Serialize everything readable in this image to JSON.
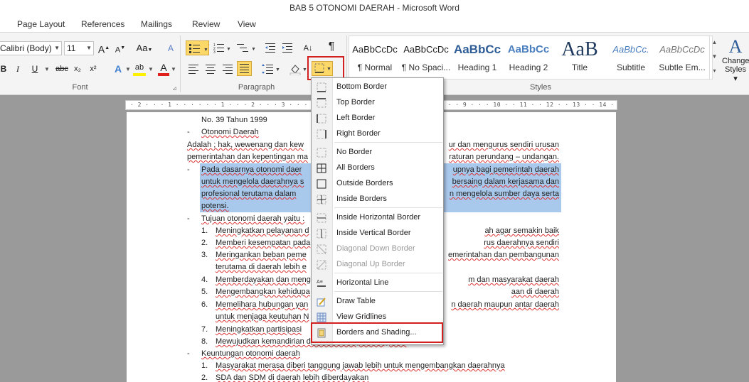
{
  "window": {
    "title": "BAB 5 OTONOMI DAERAH  -  Microsoft Word"
  },
  "tabs": [
    "Page Layout",
    "References",
    "Mailings",
    "Review",
    "View"
  ],
  "font": {
    "name": "Calibri (Body)",
    "size": "11",
    "grow": "A",
    "shrink": "A",
    "case": "Aa",
    "clear": "A"
  },
  "font_buttons": {
    "bold": "B",
    "italic": "I",
    "underline": "U",
    "strike": "abc",
    "sub": "x₂",
    "sup": "x²",
    "effects": "A",
    "highlight": "ab",
    "color": "A"
  },
  "groups": {
    "font": "Font",
    "paragraph": "Paragraph",
    "styles": "Styles"
  },
  "paragraph": {
    "pilcrow": "¶",
    "sort": "A↓"
  },
  "styles": [
    {
      "sample": "AaBbCcDc",
      "name": "¶ Normal"
    },
    {
      "sample": "AaBbCcDc",
      "name": "¶ No Spaci..."
    },
    {
      "sample": "AaBbCc",
      "name": "Heading 1"
    },
    {
      "sample": "AaBbCc",
      "name": "Heading 2"
    },
    {
      "sample": "AaB",
      "name": "Title"
    },
    {
      "sample": "AaBbCc.",
      "name": "Subtitle"
    },
    {
      "sample": "AaBbCcDc",
      "name": "Subtle Em..."
    }
  ],
  "change_styles": {
    "line1": "Change",
    "line2": "Styles ▾"
  },
  "ruler": {
    "text": "· 2 · · · 1 · · · · · · 1 · · · 2 · · · 3 · · · 4 · · · 5 · · · 6 · · · 7 · · · 8 · · · 9 · · · 10 · · 11 · · 12 · · 13 · · 14 · · 15 · · · · 17 · · 18 · · 19"
  },
  "document": {
    "l1": "No. 39 Tahun 1999",
    "l2_bullet": "-",
    "l2": "Otonomi Daerah",
    "l3a": "Adalah ; hak, wewenang dan kew",
    "l3b": "ur dan mengurus sendiri urusan",
    "l4a": "pemerintahan dan kepentingan ma",
    "l4b": "raturan perundang – undangan.",
    "p1_bullet": "-",
    "p1_1a": "Pada dasarnya otonomi daer",
    "p1_1b": "upnya bagi pemerintah daerah",
    "p1_2a": "untuk mengelola daerahnya s",
    "p1_2b": "bersaing dalam kerjasama dan",
    "p1_3a": "profesional terutama dalam",
    "p1_3b": "n mengelola sumber daya serta",
    "p1_4": "potensi.",
    "t_bullet": "-",
    "t": "Tujuan otonomi daerah yaitu :",
    "items": [
      {
        "n": "1.",
        "a": "Meningkatkan pelayanan d",
        "b": "ah agar semakin baik"
      },
      {
        "n": "2.",
        "a": "Memberi kesempatan pada",
        "b": "rus daerahnya sendiri"
      },
      {
        "n": "3.",
        "a": "Meringankan beban peme",
        "b": "emerintahan dan pembangunan"
      },
      {
        "n": "",
        "a": "terutama di daerah lebih e",
        "b": ""
      },
      {
        "n": "4.",
        "a": "Memberdayakan dan meng",
        "b": "m dan masyarakat daerah"
      },
      {
        "n": "5.",
        "a": "Mengembangkan kehidupa",
        "b": "aan di daerah"
      },
      {
        "n": "6.",
        "a": "Memelihara hubungan yan",
        "b": "n daerah maupun antar daerah"
      },
      {
        "n": "",
        "a": "untuk menjaga keutuhan N",
        "b": ""
      },
      {
        "n": "7.",
        "a": "Meningkatkan partisipasi",
        "b": ""
      },
      {
        "n": "8.",
        "a": "Mewujudkan kemandirian daerah dalam pembangunan",
        "b": ""
      }
    ],
    "k_bullet": "-",
    "k": "Keuntungan otonomi daerah",
    "k1n": "1.",
    "k1": "Masyarakat merasa diberi tanggung jawab lebih untuk mengembangkan daerahnya",
    "k2n": "2.",
    "k2": "SDA dan SDM di daerah lebih diberdayakan"
  },
  "menu": {
    "items": [
      {
        "label": "Bottom Border",
        "icon": "bottom-border-icon",
        "disabled": false
      },
      {
        "label": "Top Border",
        "icon": "top-border-icon",
        "disabled": false
      },
      {
        "label": "Left Border",
        "icon": "left-border-icon",
        "disabled": false
      },
      {
        "label": "Right Border",
        "icon": "right-border-icon",
        "disabled": false
      },
      {
        "label": "No Border",
        "icon": "no-border-icon",
        "disabled": false
      },
      {
        "label": "All Borders",
        "icon": "all-borders-icon",
        "disabled": false
      },
      {
        "label": "Outside Borders",
        "icon": "outside-borders-icon",
        "disabled": false
      },
      {
        "label": "Inside Borders",
        "icon": "inside-borders-icon",
        "disabled": false
      },
      {
        "label": "Inside Horizontal Border",
        "icon": "inside-horizontal-border-icon",
        "disabled": false
      },
      {
        "label": "Inside Vertical Border",
        "icon": "inside-vertical-border-icon",
        "disabled": false
      },
      {
        "label": "Diagonal Down Border",
        "icon": "diagonal-down-border-icon",
        "disabled": true
      },
      {
        "label": "Diagonal Up Border",
        "icon": "diagonal-up-border-icon",
        "disabled": true
      },
      {
        "label": "Horizontal Line",
        "icon": "horizontal-line-icon",
        "disabled": false
      },
      {
        "label": "Draw Table",
        "icon": "draw-table-icon",
        "disabled": false
      },
      {
        "label": "View Gridlines",
        "icon": "view-gridlines-icon",
        "disabled": false
      },
      {
        "label": "Borders and Shading...",
        "icon": "borders-shading-icon",
        "disabled": false
      }
    ]
  },
  "colors": {
    "accent_orange": "#fbd868",
    "highlight_box": "#d21f1f",
    "selection": "#a8c8ec"
  }
}
